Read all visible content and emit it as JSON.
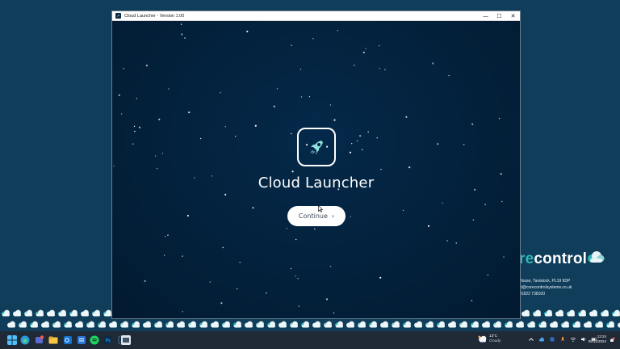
{
  "window": {
    "title": "Cloud Launcher - Version 1.00",
    "controls": {
      "minimize": "—",
      "maximize": "☐",
      "close": "✕"
    }
  },
  "app": {
    "name": "Cloud Launcher",
    "continue_label": "Continue",
    "continue_chevron": "›",
    "logo_icon": "rocket-icon"
  },
  "desktop": {
    "brand_name_accent": "re",
    "brand_name_rest": "control",
    "address": "House, Tavistock, PL19 9DP",
    "email": "ct@corecontrolsystems.co.uk",
    "phone": "01822 738100"
  },
  "taskbar": {
    "weather_temp": "13°C",
    "weather_desc": "Cloudy",
    "time": "13:24",
    "date": "08/11/2024"
  },
  "colors": {
    "window_bg": "#03223d",
    "desktop_bg": "#0f3d5a",
    "accent_teal": "#2fb5b6",
    "taskbar_bg": "#1f2a36"
  }
}
